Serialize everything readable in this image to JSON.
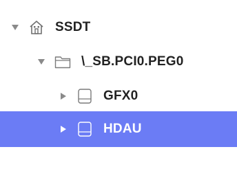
{
  "tree": {
    "nodes": [
      {
        "label": "SSDT",
        "icon": "home-icon",
        "disclosure": "expanded",
        "selected": false
      },
      {
        "label": "\\_SB.PCI0.PEG0",
        "icon": "folder-icon",
        "disclosure": "expanded",
        "selected": false
      },
      {
        "label": "GFX0",
        "icon": "drive-icon",
        "disclosure": "collapsed",
        "selected": false
      },
      {
        "label": "HDAU",
        "icon": "drive-icon",
        "disclosure": "collapsed",
        "selected": true
      }
    ]
  },
  "colors": {
    "selection": "#6b7cf5",
    "icon_stroke": "#7a7a7a",
    "disclosure": "#8a8a8a"
  }
}
